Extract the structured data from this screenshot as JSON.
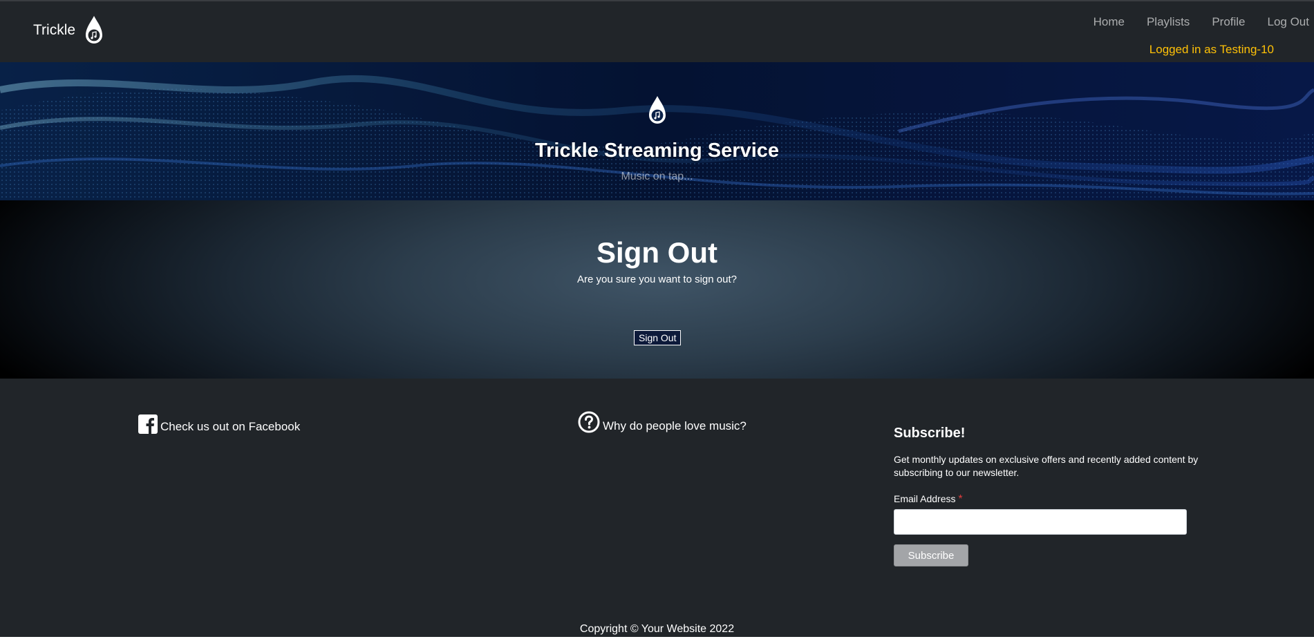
{
  "navbar": {
    "brand": "Trickle",
    "brand_icon": "water-drop-music-icon",
    "links": [
      "Home",
      "Playlists",
      "Profile",
      "Log Out"
    ],
    "logged_in_text": "Logged in as Testing-10",
    "logged_in_color": "#ffc107"
  },
  "hero": {
    "icon": "water-drop-music-icon",
    "title": "Trickle Streaming Service",
    "subtitle": "Music on tap..."
  },
  "signout": {
    "title": "Sign Out",
    "message": "Are you sure you want to sign out?",
    "button_label": "Sign Out"
  },
  "footer": {
    "facebook_icon": "facebook-icon",
    "facebook_text": "Check us out on Facebook",
    "question_icon": "question-circle-icon",
    "love_text": "Why do people love music?",
    "subscribe": {
      "title": "Subscribe!",
      "description": "Get monthly updates on exclusive offers and recently added content by subscribing to our newsletter.",
      "email_label": "Email Address",
      "required_marker": "*",
      "email_value": "",
      "button_label": "Subscribe"
    },
    "copyright": "Copyright © Your Website 2022"
  },
  "colors": {
    "navbar_bg": "#212529",
    "footer_bg": "#212529",
    "hero_bg": "#04102a",
    "required_star": "#e03c3c"
  }
}
